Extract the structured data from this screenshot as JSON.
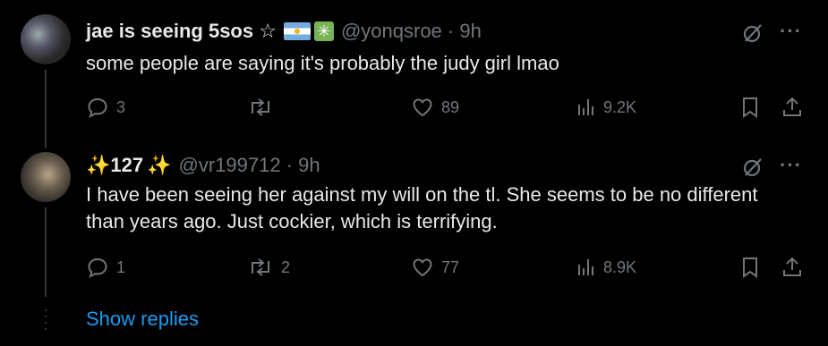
{
  "tweets": [
    {
      "name": "jae is seeing 5sos ☆",
      "badges": [
        "argentina-flag",
        "sparkle-emoji"
      ],
      "handle_time": "@yonqsroe · 9h",
      "text": "some people are saying it's probably the judy girl lmao",
      "replies": "3",
      "reposts": "",
      "likes": "89",
      "views": "9.2K"
    },
    {
      "name": "127",
      "badges": [
        "sparkles-emoji",
        "sparkles-emoji"
      ],
      "handle_time": "@vr199712 · 9h",
      "text": "I have been seeing her against my will on the tl. She seems to be no different than years ago. Just cockier, which is terrifying.",
      "replies": "1",
      "reposts": "2",
      "likes": "77",
      "views": "8.9K"
    }
  ],
  "show_replies": "Show replies",
  "colors": {
    "background": "#000000",
    "text": "#e7e9ea",
    "muted": "#71767b",
    "link": "#1d9bf0"
  }
}
